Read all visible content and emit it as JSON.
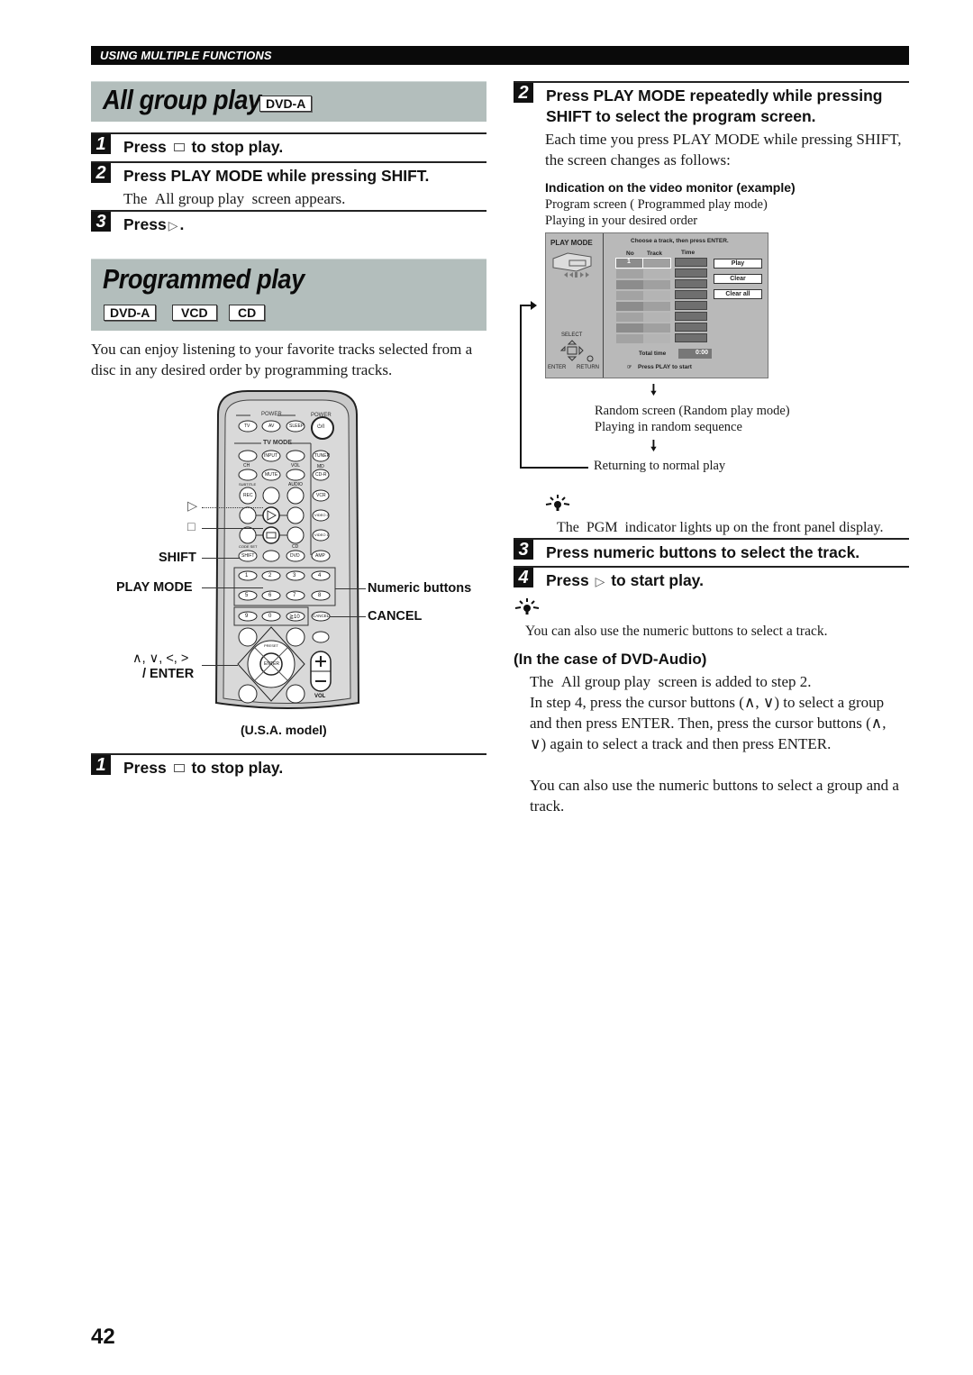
{
  "section_header": "USING MULTIPLE FUNCTIONS",
  "all_group_play": {
    "title": "All group play",
    "badge": "DVD-A",
    "steps": [
      {
        "num": "1",
        "text_pre": "Press",
        "icon": "stop-icon",
        "text_post": "to stop play."
      },
      {
        "num": "2",
        "text": "Press PLAY MODE while pressing SHIFT.",
        "note": "The  All group play  screen appears."
      },
      {
        "num": "3",
        "text_pre": "Press",
        "icon": "play-icon",
        "text_post": "."
      }
    ]
  },
  "programmed_play": {
    "title": "Programmed play",
    "badges": [
      "DVD-A",
      "VCD",
      "CD"
    ],
    "intro": "You can enjoy listening to your favorite tracks selected from a disc in any desired order by programming tracks.",
    "remote": {
      "callouts_left": {
        "play": "▷",
        "stop": "□",
        "shift": "SHIFT",
        "play_mode": "PLAY MODE",
        "cursor": "∧, ∨, <, >",
        "enter": "/ ENTER"
      },
      "callouts_right": {
        "numeric": "Numeric buttons",
        "cancel": "CANCEL"
      },
      "model": "(U.S.A. model)",
      "labels": {
        "power_group": "POWER",
        "power": "POWER",
        "tv": "TV",
        "av": "AV",
        "sleep": "SLEEP",
        "standby": "⏻/I",
        "tv_mode": "TV MODE",
        "ch": "CH",
        "vol": "VOL",
        "input": "INPUT",
        "mute": "MUTE",
        "tuner": "TUNER",
        "md": "MD",
        "cdr": "CD-R",
        "subtitle": "SUBTITLE",
        "audio": "AUDIO",
        "rec": "REC",
        "vcr": "VCR",
        "video2": "VIDEO 2",
        "video1": "VIDEO 1",
        "code_set": "CODE SET",
        "cd": "CD",
        "shift": "SHIFT",
        "dvd": "DVD",
        "amp": "AMP",
        "numbers": [
          "1",
          "2",
          "3",
          "4",
          "5",
          "6",
          "7",
          "8",
          "9",
          "0",
          "≧10"
        ],
        "cancel": "CANCEL",
        "enter": "ENTER",
        "preset": "PRESET",
        "vol_label": "VOL"
      }
    },
    "steps": [
      {
        "num": "1",
        "text_pre": "Press",
        "icon": "stop-icon",
        "text_post": "to stop play."
      },
      {
        "num": "2",
        "text": "Press PLAY MODE repeatedly while pressing SHIFT to select the program screen.",
        "note": "Each time you press PLAY MODE while pressing SHIFT, the screen changes as follows:"
      },
      {
        "num": "3",
        "text": "Press numeric buttons to select the track."
      },
      {
        "num": "4",
        "text_pre": "Press",
        "icon": "play-icon",
        "text_post": "to start play."
      }
    ],
    "flow": {
      "heading": "Indication on the video monitor (example)",
      "program_screen": "Program screen ( Programmed play mode)",
      "program_desc": "Playing in your desired order",
      "random_screen": "Random screen (Random play mode)",
      "random_desc": "Playing in random sequence",
      "normal": "Returning to normal play"
    },
    "monitor": {
      "mode_label": "PLAY MODE",
      "instruction": "Choose a track, then press ENTER.",
      "columns": [
        "No",
        "Track",
        "Time"
      ],
      "first_row_no": "1",
      "buttons": [
        "Play",
        "Clear",
        "Clear all"
      ],
      "total_time_label": "Total time",
      "total_time_value": "0:00",
      "select_label": "SELECT",
      "enter_label": "ENTER",
      "return_label": "RETURN",
      "hint": "Press PLAY to start"
    },
    "tip1": "The  PGM  indicator lights up on the front panel display.",
    "tip2": "You can also use the numeric buttons to select a track.",
    "dvd_audio": {
      "heading": "(In the case of DVD-Audio)",
      "lines": [
        "The  All group play  screen is added to step 2.",
        "In step 4, press the cursor buttons (∧, ∨) to select a group and then press ENTER. Then, press the cursor buttons (∧, ∨) again to select a track and then press ENTER.",
        "You can also use the numeric buttons to select a group and a track."
      ]
    }
  },
  "page_number": "42"
}
